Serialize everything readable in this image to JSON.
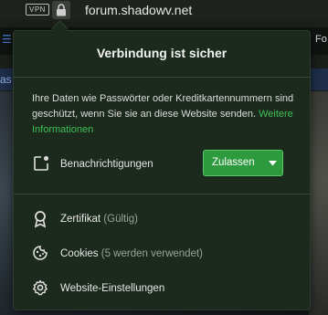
{
  "topbar": {
    "vpn_label": "VPN",
    "url": "forum.shadowv.net"
  },
  "background": {
    "right_text": "Fo",
    "left_blue_text": "as"
  },
  "popup": {
    "title": "Verbindung ist sicher",
    "info_text": "Ihre Daten wie Passwörter oder Kreditkartennummern sind geschützt, wenn Sie sie an diese Website senden.",
    "info_link": "Weitere Informationen",
    "notifications_label": "Benachrichtigungen",
    "allow_button_label": "Zulassen",
    "certificate_label": "Zertifikat",
    "certificate_status": "(Gültig)",
    "cookies_label": "Cookies",
    "cookies_status": "(5 werden verwendet)",
    "site_settings_label": "Website-Einstellungen"
  },
  "colors": {
    "popup_bg": "#1c2a1e",
    "accent_green": "#2d9a3e",
    "link_green": "#3fbf55"
  },
  "icons": {
    "lock": "lock-icon",
    "notifications": "notification-icon",
    "certificate": "certificate-icon",
    "cookies": "cookie-icon",
    "settings": "gear-icon"
  }
}
